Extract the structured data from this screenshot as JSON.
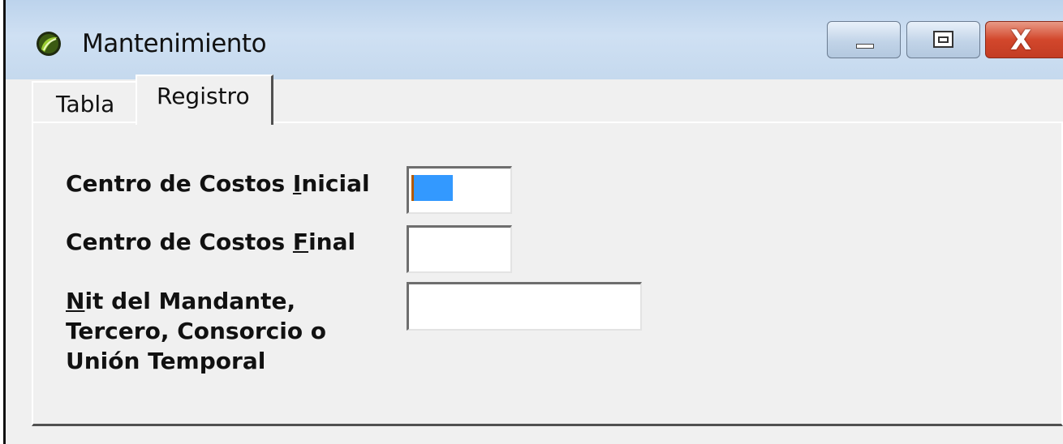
{
  "window": {
    "title": "Mantenimiento",
    "icon": "app-logo-icon",
    "controls": {
      "minimize": "minimize-icon",
      "maximize": "maximize-icon",
      "close": "close-icon",
      "close_glyph": "X"
    }
  },
  "tabs": [
    {
      "label": "Tabla",
      "active": false
    },
    {
      "label": "Registro",
      "active": true
    }
  ],
  "form": {
    "centro_inicial": {
      "before": "Centro de Costos ",
      "accel": "I",
      "after": "nicial",
      "value": ""
    },
    "centro_final": {
      "before": "Centro de Costos ",
      "accel": "F",
      "after": "inal",
      "value": ""
    },
    "nit": {
      "accel": "N",
      "line1": "it del Mandante,",
      "line2": "Tercero, Consorcio o",
      "line3": "Unión Temporal",
      "value": ""
    }
  },
  "colors": {
    "selection": "#3399ff",
    "close_button": "#d2472c",
    "titlebar": "#c5d9ee",
    "window_bg": "#f0f0f0"
  }
}
